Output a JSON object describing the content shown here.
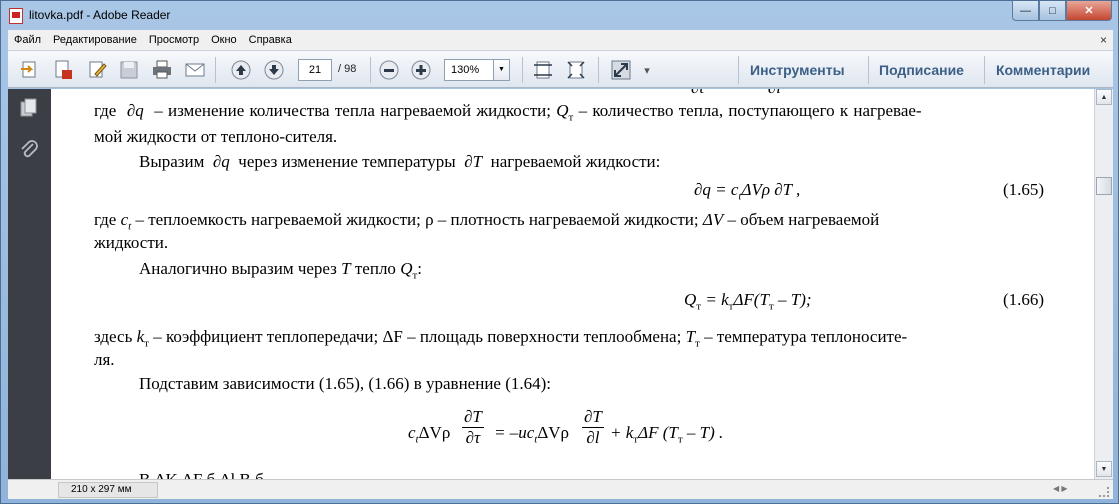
{
  "window": {
    "title": "litovka.pdf - Adobe Reader",
    "minimize": "—",
    "maximize": "□",
    "close": "✕"
  },
  "menu": {
    "items": [
      "Файл",
      "Редактирование",
      "Просмотр",
      "Окно",
      "Справка"
    ],
    "close_glyph": "×"
  },
  "toolbar": {
    "page_current": "21",
    "page_total": "/ 98",
    "zoom": "130%",
    "dropdown_glyph": "▼",
    "more_glyph": "▾",
    "links": [
      "Инструменты",
      "Подписание",
      "Комментарии"
    ]
  },
  "statusbar": {
    "page_size": "210 x 297 мм",
    "scroll_glyph": "◀ ▶"
  },
  "scrollbar": {
    "up_glyph": "▲",
    "down_glyph": "▼"
  },
  "document": {
    "line1_a": "где",
    "line1_dq": "∂q",
    "line1_b": "– изменение количества тепла нагреваемой жидкости;",
    "line1_Q": "Q",
    "line1_Qsub": "т",
    "line1_c": "– количество тепла, поступающего к нагревае-",
    "line2": "мой жидкости от теплоно-сителя.",
    "line3_a": "Выразим",
    "line3_dq": "∂q",
    "line3_b": "через изменение температуры",
    "line3_dT": "∂T",
    "line3_c": "нагреваемой жидкости:",
    "eq165": "∂q  = c",
    "eq165_sub": "t",
    "eq165_rest": "ΔVρ ∂T ,",
    "eq165_num": "(1.65)",
    "line4_a": "где",
    "line4_c": "c",
    "line4_csub": "t",
    "line4_b": "– теплоемкость нагреваемой жидкости; ρ – плотность нагреваемой жидкости;",
    "line4_dV": "ΔV",
    "line4_d": "– объем нагреваемой",
    "line5": "жидкости.",
    "line6_a": "Аналогично выразим через",
    "line6_T": "T",
    "line6_b": "тепло",
    "line6_Q": "Q",
    "line6_Qsub": "т",
    "line6_c": ":",
    "eq166_Q": "Q",
    "eq166_Qsub": "т",
    "eq166_mid": "= k",
    "eq166_ksub": "т",
    "eq166_rest": "ΔF(T",
    "eq166_Tsub": "т",
    "eq166_end": "– T);",
    "eq166_num": "(1.66)",
    "line7_a": "здесь",
    "line7_k": "k",
    "line7_ksub": "т",
    "line7_b": "– коэффициент теплопередачи; ΔF – площадь поверхности теплообмена;",
    "line7_T": "T",
    "line7_Tsub": "т",
    "line7_c": "– температура теплоносите-",
    "line8": "ля.",
    "line9": "Подставим зависимости (1.65), (1.66) в уравнение (1.64):",
    "eq_final_left": "c",
    "eq_final_left_sub": "t",
    "eq_final_left_rest": "ΔVρ",
    "eq_frac1_num": "∂T",
    "eq_frac1_den": "∂τ",
    "eq_final_mid": "= –uc",
    "eq_final_mid_sub": "t",
    "eq_final_mid_rest": "ΔVρ",
    "eq_frac2_num": "∂T",
    "eq_frac2_den": "∂l",
    "eq_final_plus": "+ k",
    "eq_final_plus_sub": "т",
    "eq_final_end": "ΔF (T",
    "eq_final_end_sub": "т",
    "eq_final_close": "– T) .",
    "bottom_partial": "В           ΔK    ΔF                                б   Δl                   В     б"
  }
}
